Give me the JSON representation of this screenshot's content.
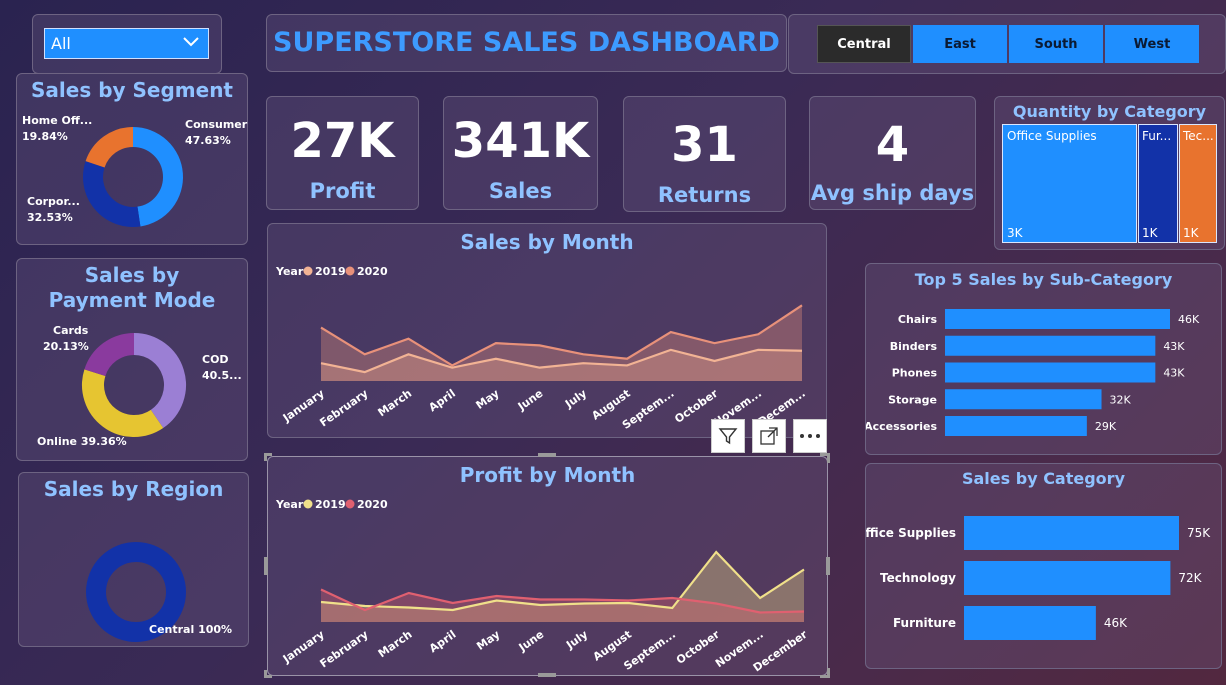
{
  "filter": {
    "value": "All"
  },
  "dashboard_title": "SUPERSTORE SALES DASHBOARD",
  "region_buttons": [
    {
      "label": "Central",
      "active": true
    },
    {
      "label": "East",
      "active": false
    },
    {
      "label": "South",
      "active": false
    },
    {
      "label": "West",
      "active": false
    }
  ],
  "kpis": [
    {
      "value": "27K",
      "label": "Profit"
    },
    {
      "value": "341K",
      "label": "Sales"
    },
    {
      "value": "31",
      "label": "Returns"
    },
    {
      "value": "4",
      "label": "Avg ship days"
    }
  ],
  "colors": {
    "accent": "#1f8fff",
    "title": "#8fc2ff",
    "dark_blue": "#1232a8",
    "orange": "#e8732e",
    "purple": "#8a4ab0",
    "lavender": "#9b7fd4",
    "yellow": "#e6c531"
  },
  "chart_data": [
    {
      "type": "pie",
      "title": "Sales by Segment",
      "labels": [
        "Consumer",
        "Corpor...",
        "Home Off..."
      ],
      "values": [
        47.63,
        32.53,
        19.84
      ],
      "value_labels": [
        "47.63%",
        "32.53%",
        "19.84%"
      ],
      "colors": [
        "#1f8fff",
        "#1232a8",
        "#e8732e"
      ]
    },
    {
      "type": "pie",
      "title": "Sales by Payment Mode",
      "labels": [
        "COD",
        "Online",
        "Cards"
      ],
      "values": [
        40.51,
        39.36,
        20.13
      ],
      "value_labels": [
        "40.5...",
        "39.36%",
        "20.13%"
      ],
      "colors": [
        "#9b7fd4",
        "#e6c531",
        "#8a3a9e"
      ]
    },
    {
      "type": "pie",
      "title": "Sales by Region",
      "labels": [
        "Central"
      ],
      "values": [
        100
      ],
      "value_labels": [
        "100%"
      ],
      "colors": [
        "#1232a8"
      ]
    },
    {
      "type": "area",
      "title": "Sales by Month",
      "legend_title": "Year",
      "categories": [
        "January",
        "February",
        "March",
        "April",
        "May",
        "June",
        "July",
        "August",
        "Septem...",
        "October",
        "Novem...",
        "Decem..."
      ],
      "series": [
        {
          "name": "2019",
          "color": "#f2b394",
          "values": [
            14,
            12,
            16,
            13,
            15,
            13,
            14,
            13.5,
            17,
            14.5,
            17,
            16.8
          ]
        },
        {
          "name": "2020",
          "color": "#e8917a",
          "values": [
            22,
            16,
            19.5,
            13.5,
            18.5,
            18,
            16,
            15,
            21,
            18.5,
            20.5,
            27
          ]
        }
      ],
      "ylim": [
        10,
        30
      ]
    },
    {
      "type": "area",
      "title": "Profit by Month",
      "legend_title": "Year",
      "categories": [
        "January",
        "February",
        "March",
        "April",
        "May",
        "June",
        "July",
        "August",
        "Septem...",
        "October",
        "Novem...",
        "December"
      ],
      "series": [
        {
          "name": "2019",
          "color": "#f0e08a",
          "values": [
            0,
            -0.8,
            -1.1,
            -1.6,
            0.3,
            -0.6,
            -0.3,
            -0.2,
            -1.2,
            10,
            0.8,
            6.5
          ]
        },
        {
          "name": "2020",
          "color": "#e06070",
          "values": [
            2.5,
            -1.6,
            1.8,
            -0.2,
            1.2,
            0.5,
            0.5,
            0.3,
            0.8,
            -0.3,
            -2.1,
            -1.9
          ]
        }
      ],
      "ylim": [
        -4,
        14
      ]
    },
    {
      "type": "treemap",
      "title": "Quantity by Category",
      "labels": [
        "Office Supplies",
        "Fur...",
        "Tec..."
      ],
      "values": [
        3000,
        1000,
        1000
      ],
      "value_labels": [
        "3K",
        "1K",
        "1K"
      ],
      "colors": [
        "#1f8fff",
        "#1232a8",
        "#e8732e"
      ]
    },
    {
      "type": "bar",
      "title": "Top 5 Sales by Sub-Category",
      "categories": [
        "Chairs",
        "Binders",
        "Phones",
        "Storage",
        "Accessories"
      ],
      "values": [
        46,
        43,
        43,
        32,
        29
      ],
      "value_labels": [
        "46K",
        "43K",
        "43K",
        "32K",
        "29K"
      ],
      "orientation": "horizontal"
    },
    {
      "type": "bar",
      "title": "Sales by Category",
      "categories": [
        "Office Supplies",
        "Technology",
        "Furniture"
      ],
      "values": [
        75,
        72,
        46
      ],
      "value_labels": [
        "75K",
        "72K",
        "46K"
      ],
      "orientation": "horizontal"
    }
  ]
}
